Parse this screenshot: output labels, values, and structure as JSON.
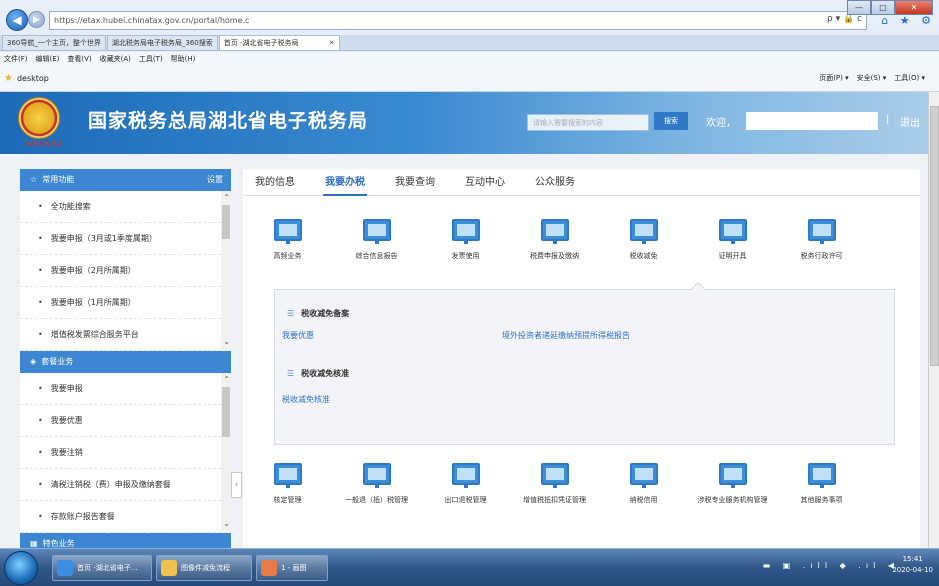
{
  "browser": {
    "url": "https://etax.hubei.chinatax.gov.cn/portal/home.c",
    "url_tools": "ρ ▾ 🔒 c",
    "win_min": "—",
    "win_max": "□",
    "win_close": "✕",
    "top_icons": "⌂ ★ ⚙",
    "tabs": [
      {
        "label": "360导航_一个主页，整个世界"
      },
      {
        "label": "湖北税务局电子税务局_360搜索"
      },
      {
        "label": "首页 -湖北省电子税务局"
      }
    ],
    "tab_close": "✕",
    "menu": [
      "文件(F)",
      "编辑(E)",
      "查看(V)",
      "收藏夹(A)",
      "工具(T)",
      "帮助(H)"
    ],
    "favorites_label": "desktop",
    "command_bar": [
      "页面(P) ▾",
      "安全(S) ▾",
      "工具(O) ▾"
    ]
  },
  "header": {
    "emblem_sub": "国家税务总局",
    "title": "国家税务总局湖北省电子税务局",
    "search_placeholder": "请输入需要搜索的内容",
    "search_button": "搜索",
    "welcome": "欢迎，",
    "separator": "|",
    "logout": "退出"
  },
  "sidebar": {
    "section1": {
      "title": "常用功能",
      "settings": "设置"
    },
    "common_items": [
      {
        "label": "全功能搜索"
      },
      {
        "label": "我要申报（3月或1季度属期）"
      },
      {
        "label": "我要申报（2月所属期）"
      },
      {
        "label": "我要申报（1月所属期）"
      },
      {
        "label": "增值税发票综合服务平台"
      }
    ],
    "section2": {
      "title": "套餐业务"
    },
    "package_items": [
      {
        "label": "我要申报"
      },
      {
        "label": "我要优惠"
      },
      {
        "label": "我要注销"
      },
      {
        "label": "清税注销税（费）申报及缴纳套餐"
      },
      {
        "label": "存款账户报告套餐"
      }
    ],
    "section3": {
      "title": "特色业务"
    }
  },
  "main": {
    "tabs": [
      {
        "label": "我的信息"
      },
      {
        "label": "我要办税"
      },
      {
        "label": "我要查询"
      },
      {
        "label": "互动中心"
      },
      {
        "label": "公众服务"
      }
    ],
    "services_row1": [
      {
        "label": "高频业务",
        "icon": "monitor-icon"
      },
      {
        "label": "综合信息报告",
        "icon": "monitor-icon"
      },
      {
        "label": "发票使用",
        "icon": "monitor-icon"
      },
      {
        "label": "税费申报及缴纳",
        "icon": "monitor-icon"
      },
      {
        "label": "税收减免",
        "icon": "monitor-icon"
      },
      {
        "label": "证明开具",
        "icon": "monitor-icon"
      },
      {
        "label": "税务行政许可",
        "icon": "monitor-icon"
      }
    ],
    "panel": {
      "section1_title": "税收减免备案",
      "link_preferential": "我要优惠",
      "link_overseas": "境外投资者递延缴纳预提所得税报告",
      "section2_title": "税收减免核准",
      "link_approval": "税收减免核准"
    },
    "services_row2": [
      {
        "label": "核定管理",
        "icon": "monitor-icon"
      },
      {
        "label": "一般退（抵）税管理",
        "icon": "monitor-icon"
      },
      {
        "label": "出口退税管理",
        "icon": "monitor-icon"
      },
      {
        "label": "增值税抵扣凭证管理",
        "icon": "monitor-icon"
      },
      {
        "label": "纳税信用",
        "icon": "monitor-icon"
      },
      {
        "label": "涉税专业服务机构管理",
        "icon": "monitor-icon"
      },
      {
        "label": "其他服务事项",
        "icon": "monitor-icon"
      }
    ]
  },
  "taskbar": {
    "tasks": [
      {
        "label": "首页 -湖北省电子..."
      },
      {
        "label": "图像件减免流程"
      },
      {
        "label": "1 - 画图"
      }
    ],
    "tray": "▬ ▣ .ıll ◆ .ıl ◀",
    "time": "15:41",
    "date": "2020-04-10"
  },
  "colors": {
    "accent": "#2f6fc0",
    "sidebar_head": "#3d86d1",
    "banner": "#1d6bb8"
  }
}
